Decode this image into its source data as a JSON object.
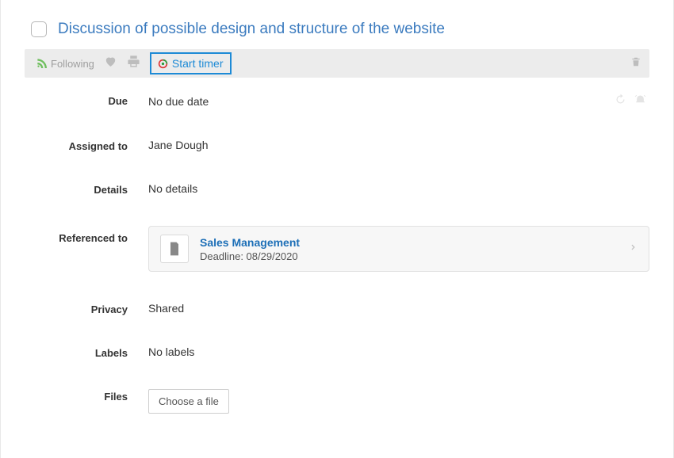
{
  "task": {
    "title": "Discussion of possible design and structure of the website"
  },
  "toolbar": {
    "following_label": "Following",
    "start_timer_label": "Start timer"
  },
  "fields": {
    "due": {
      "label": "Due",
      "value": "No due date"
    },
    "assigned_to": {
      "label": "Assigned to",
      "value": "Jane Dough"
    },
    "details": {
      "label": "Details",
      "value": "No details"
    },
    "referenced_to": {
      "label": "Referenced to",
      "item": {
        "title": "Sales Management",
        "deadline_prefix": "Deadline: ",
        "deadline": "08/29/2020"
      }
    },
    "privacy": {
      "label": "Privacy",
      "value": "Shared"
    },
    "labels": {
      "label": "Labels",
      "value": "No labels"
    },
    "files": {
      "label": "Files",
      "button": "Choose a file"
    }
  }
}
